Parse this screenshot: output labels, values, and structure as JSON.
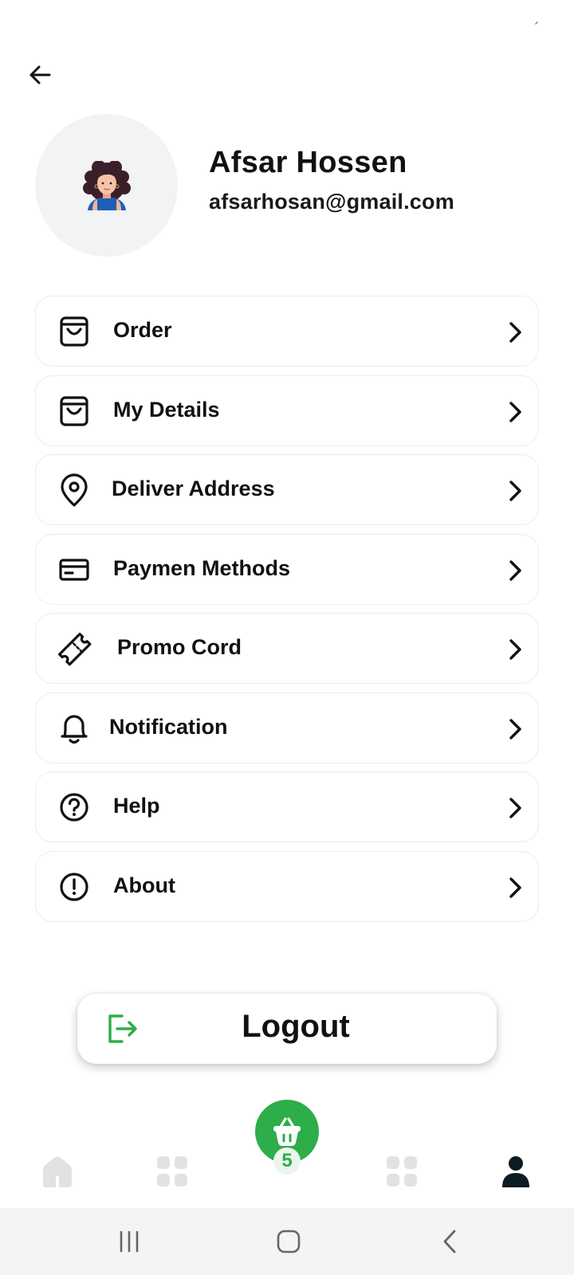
{
  "profile": {
    "name": "Afsar Hossen",
    "email": "afsarhosan@gmail.com"
  },
  "menu": {
    "items": [
      {
        "label": "Order",
        "icon": "shopping-bag-icon"
      },
      {
        "label": "My Details",
        "icon": "shopping-bag-icon"
      },
      {
        "label": "Deliver Address",
        "icon": "location-pin-icon"
      },
      {
        "label": "Paymen Methods",
        "icon": "credit-card-icon"
      },
      {
        "label": "Promo Cord",
        "icon": "ticket-icon"
      },
      {
        "label": "Notification",
        "icon": "bell-icon"
      },
      {
        "label": "Help",
        "icon": "help-circle-icon"
      },
      {
        "label": "About",
        "icon": "info-circle-icon"
      }
    ]
  },
  "logout": {
    "label": "Logout",
    "icon": "logout-icon"
  },
  "bottom_nav": {
    "tabs": [
      "home-icon",
      "grid-icon",
      "cart-icon",
      "grid-icon",
      "profile-icon"
    ],
    "cart_count": "5",
    "active": "profile"
  },
  "colors": {
    "accent": "#2ead4b",
    "text": "#111111",
    "avatar_bg": "#f2f3f5",
    "inactive_icon": "#e0e0e0",
    "system_bar": "#f4f4f4"
  }
}
